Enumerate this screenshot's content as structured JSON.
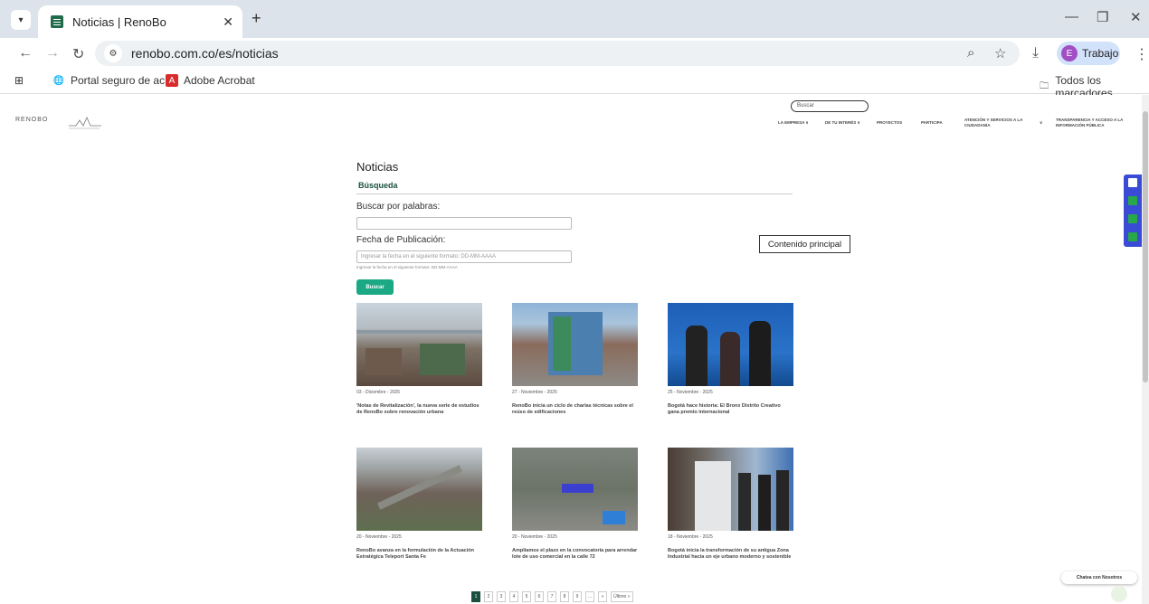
{
  "browser": {
    "tab_title": "Noticias | RenoBo",
    "tab_close": "✕",
    "new_tab": "+",
    "url": "renobo.com.co/es/noticias",
    "profile_label": "Trabajo",
    "profile_initial": "E",
    "bookmarks": [
      "Portal seguro de ac...",
      "Adobe Acrobat"
    ],
    "all_bookmarks": "Todos los marcadores"
  },
  "header": {
    "search_placeholder": "Buscar",
    "logo_text": "RENOBO",
    "menu": [
      "LA EMPRESA ∨",
      "DE TU INTERÉS ∨",
      "PROYECTOS",
      "PARTICIPA",
      "ATENCIÓN Y SERVICIOS A LA CIUDADANÍA",
      "∨",
      "TRANSPARENCIA Y ACCESO A LA INFORMACIÓN PÚBLICA"
    ]
  },
  "main": {
    "title": "Noticias",
    "search_heading": "Búsqueda",
    "keyword_label": "Buscar por palabras:",
    "date_label": "Fecha de Publicación:",
    "date_placeholder": "Ingresar la fecha en el siguiente formato: DD-MM-AAAA",
    "date_hint": "Ingresar la fecha en el siguiente formato: DD-MM-AAAA",
    "search_button": "Buscar",
    "skip_link": "Contenido principal"
  },
  "news": [
    {
      "date": "03 - Diciembre - 2025",
      "title": "'Notas de Revitalización', la nueva serie de estudios de RenoBo sobre renovación urbana"
    },
    {
      "date": "27 - Noviembre - 2025",
      "title": "RenoBo inicia un ciclo de charlas técnicas sobre el reúso de edificaciones"
    },
    {
      "date": "25 - Noviembre - 2025",
      "title": "Bogotá hace historia: El Bronx Distrito Creativo gana premio internacional"
    },
    {
      "date": "20 - Noviembre - 2025",
      "title": "RenoBo avanza en la formulación de la Actuación Estratégica Teleport Santa Fe"
    },
    {
      "date": "20 - Noviembre - 2025",
      "title": "Ampliamos el plazo en la convocatoria para arrendar lote de uso comercial en la calle 72"
    },
    {
      "date": "18 - Noviembre - 2025",
      "title": "Bogotá inicia la transformación de su antigua Zona Industrial hacia un eje urbano moderno y sostenible"
    }
  ],
  "pagination": {
    "pages": [
      "1",
      "2",
      "3",
      "4",
      "5",
      "6",
      "7",
      "8",
      "9",
      "...",
      "»",
      "Último »"
    ],
    "current": "1"
  },
  "chat": {
    "label": "Chatea con Nosotros"
  }
}
